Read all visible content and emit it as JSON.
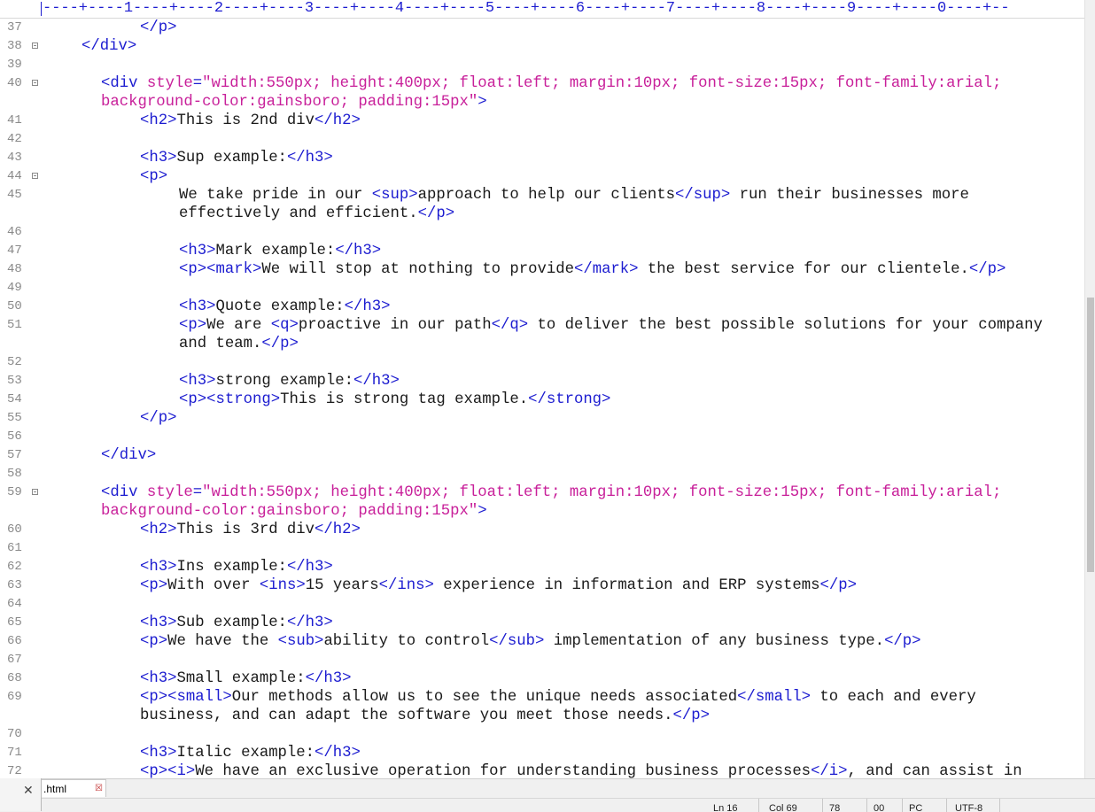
{
  "ruler": {
    "text": "----+----1----+----2----+----3----+----4----+----5----+----6----+----7----+----8----+----9----+----0----+--"
  },
  "lines": [
    {
      "n": "37",
      "fold": false,
      "indent": 8,
      "segs": [
        [
          "t",
          "</p>"
        ]
      ]
    },
    {
      "n": "38",
      "fold": true,
      "indent": 2,
      "segs": [
        [
          "t",
          "</div>"
        ]
      ]
    },
    {
      "n": "39",
      "fold": false,
      "indent": 0,
      "segs": []
    },
    {
      "n": "40",
      "fold": true,
      "indent": 4,
      "segs": [
        [
          "t",
          "<div "
        ],
        [
          "a",
          "style"
        ],
        [
          "t",
          "="
        ],
        [
          "s",
          "\"width:550px; height:400px; float:left; margin:10px; font-size:15px; font-family:arial;"
        ]
      ]
    },
    {
      "n": "",
      "fold": false,
      "indent": 4,
      "segs": [
        [
          "s",
          "background-color:gainsboro; padding:15px\""
        ],
        [
          "t",
          ">"
        ]
      ]
    },
    {
      "n": "41",
      "fold": false,
      "indent": 8,
      "segs": [
        [
          "t",
          "<h2>"
        ],
        [
          "x",
          "This is 2nd div"
        ],
        [
          "t",
          "</h2>"
        ]
      ]
    },
    {
      "n": "42",
      "fold": false,
      "indent": 0,
      "segs": []
    },
    {
      "n": "43",
      "fold": false,
      "indent": 8,
      "segs": [
        [
          "t",
          "<h3>"
        ],
        [
          "x",
          "Sup example:"
        ],
        [
          "t",
          "</h3>"
        ]
      ]
    },
    {
      "n": "44",
      "fold": true,
      "indent": 8,
      "segs": [
        [
          "t",
          "<p>"
        ]
      ]
    },
    {
      "n": "45",
      "fold": false,
      "indent": 12,
      "segs": [
        [
          "x",
          "We take pride in our "
        ],
        [
          "t",
          "<sup>"
        ],
        [
          "x",
          "approach to help our clients"
        ],
        [
          "t",
          "</sup>"
        ],
        [
          "x",
          " run their businesses more"
        ]
      ]
    },
    {
      "n": "",
      "fold": false,
      "indent": 12,
      "segs": [
        [
          "x",
          "effectively and efficient."
        ],
        [
          "t",
          "</p>"
        ]
      ]
    },
    {
      "n": "46",
      "fold": false,
      "indent": 0,
      "segs": []
    },
    {
      "n": "47",
      "fold": false,
      "indent": 12,
      "segs": [
        [
          "t",
          "<h3>"
        ],
        [
          "x",
          "Mark example:"
        ],
        [
          "t",
          "</h3>"
        ]
      ]
    },
    {
      "n": "48",
      "fold": false,
      "indent": 12,
      "segs": [
        [
          "t",
          "<p><mark>"
        ],
        [
          "x",
          "We will stop at nothing to provide"
        ],
        [
          "t",
          "</mark>"
        ],
        [
          "x",
          " the best service for our clientele."
        ],
        [
          "t",
          "</p>"
        ]
      ]
    },
    {
      "n": "49",
      "fold": false,
      "indent": 0,
      "segs": []
    },
    {
      "n": "50",
      "fold": false,
      "indent": 12,
      "segs": [
        [
          "t",
          "<h3>"
        ],
        [
          "x",
          "Quote example:"
        ],
        [
          "t",
          "</h3>"
        ]
      ]
    },
    {
      "n": "51",
      "fold": false,
      "indent": 12,
      "segs": [
        [
          "t",
          "<p>"
        ],
        [
          "x",
          "We are "
        ],
        [
          "t",
          "<q>"
        ],
        [
          "x",
          "proactive in our path"
        ],
        [
          "t",
          "</q>"
        ],
        [
          "x",
          " to deliver the best possible solutions for your company"
        ]
      ]
    },
    {
      "n": "",
      "fold": false,
      "indent": 12,
      "segs": [
        [
          "x",
          "and team."
        ],
        [
          "t",
          "</p>"
        ]
      ]
    },
    {
      "n": "52",
      "fold": false,
      "indent": 0,
      "segs": []
    },
    {
      "n": "53",
      "fold": false,
      "indent": 12,
      "segs": [
        [
          "t",
          "<h3>"
        ],
        [
          "x",
          "strong example:"
        ],
        [
          "t",
          "</h3>"
        ]
      ]
    },
    {
      "n": "54",
      "fold": false,
      "indent": 12,
      "segs": [
        [
          "t",
          "<p><strong>"
        ],
        [
          "x",
          "This is strong tag example."
        ],
        [
          "t",
          "</strong>"
        ]
      ]
    },
    {
      "n": "55",
      "fold": false,
      "indent": 8,
      "segs": [
        [
          "t",
          "</p>"
        ]
      ]
    },
    {
      "n": "56",
      "fold": false,
      "indent": 0,
      "segs": []
    },
    {
      "n": "57",
      "fold": false,
      "indent": 4,
      "segs": [
        [
          "t",
          "</div>"
        ]
      ]
    },
    {
      "n": "58",
      "fold": false,
      "indent": 0,
      "segs": []
    },
    {
      "n": "59",
      "fold": true,
      "indent": 4,
      "segs": [
        [
          "t",
          "<div "
        ],
        [
          "a",
          "style"
        ],
        [
          "t",
          "="
        ],
        [
          "s",
          "\"width:550px; height:400px; float:left; margin:10px; font-size:15px; font-family:arial;"
        ]
      ]
    },
    {
      "n": "",
      "fold": false,
      "indent": 4,
      "segs": [
        [
          "s",
          "background-color:gainsboro; padding:15px\""
        ],
        [
          "t",
          ">"
        ]
      ]
    },
    {
      "n": "60",
      "fold": false,
      "indent": 8,
      "segs": [
        [
          "t",
          "<h2>"
        ],
        [
          "x",
          "This is 3rd div"
        ],
        [
          "t",
          "</h2>"
        ]
      ]
    },
    {
      "n": "61",
      "fold": false,
      "indent": 0,
      "segs": []
    },
    {
      "n": "62",
      "fold": false,
      "indent": 8,
      "segs": [
        [
          "t",
          "<h3>"
        ],
        [
          "x",
          "Ins example:"
        ],
        [
          "t",
          "</h3>"
        ]
      ]
    },
    {
      "n": "63",
      "fold": false,
      "indent": 8,
      "segs": [
        [
          "t",
          "<p>"
        ],
        [
          "x",
          "With over "
        ],
        [
          "t",
          "<ins>"
        ],
        [
          "x",
          "15 years"
        ],
        [
          "t",
          "</ins>"
        ],
        [
          "x",
          " experience in information and ERP systems"
        ],
        [
          "t",
          "</p>"
        ]
      ]
    },
    {
      "n": "64",
      "fold": false,
      "indent": 0,
      "segs": []
    },
    {
      "n": "65",
      "fold": false,
      "indent": 8,
      "segs": [
        [
          "t",
          "<h3>"
        ],
        [
          "x",
          "Sub example:"
        ],
        [
          "t",
          "</h3>"
        ]
      ]
    },
    {
      "n": "66",
      "fold": false,
      "indent": 8,
      "segs": [
        [
          "t",
          "<p>"
        ],
        [
          "x",
          "We have the "
        ],
        [
          "t",
          "<sub>"
        ],
        [
          "x",
          "ability to control"
        ],
        [
          "t",
          "</sub>"
        ],
        [
          "x",
          " implementation of any business type."
        ],
        [
          "t",
          "</p>"
        ]
      ]
    },
    {
      "n": "67",
      "fold": false,
      "indent": 0,
      "segs": []
    },
    {
      "n": "68",
      "fold": false,
      "indent": 8,
      "segs": [
        [
          "t",
          "<h3>"
        ],
        [
          "x",
          "Small example:"
        ],
        [
          "t",
          "</h3>"
        ]
      ]
    },
    {
      "n": "69",
      "fold": false,
      "indent": 8,
      "segs": [
        [
          "t",
          "<p><small>"
        ],
        [
          "x",
          "Our methods allow us to see the unique needs associated"
        ],
        [
          "t",
          "</small>"
        ],
        [
          "x",
          " to each and every"
        ]
      ]
    },
    {
      "n": "",
      "fold": false,
      "indent": 8,
      "segs": [
        [
          "x",
          "business, and can adapt the software you meet those needs."
        ],
        [
          "t",
          "</p>"
        ]
      ]
    },
    {
      "n": "70",
      "fold": false,
      "indent": 0,
      "segs": []
    },
    {
      "n": "71",
      "fold": false,
      "indent": 8,
      "segs": [
        [
          "t",
          "<h3>"
        ],
        [
          "x",
          "Italic example:"
        ],
        [
          "t",
          "</h3>"
        ]
      ]
    },
    {
      "n": "72",
      "fold": false,
      "indent": 8,
      "segs": [
        [
          "t",
          "<p><i>"
        ],
        [
          "x",
          "We have an exclusive operation for understanding business processes"
        ],
        [
          "t",
          "</i>"
        ],
        [
          "x",
          ", and can assist in"
        ]
      ]
    }
  ],
  "tab": {
    "label": ".html",
    "close_glyph": "☒"
  },
  "close_panel": {
    "glyph": "✕"
  },
  "status": {
    "ln": "Ln 16",
    "col": "Col 69",
    "sel": "78",
    "ovr": "00",
    "eol": "PC",
    "encoding": "UTF-8"
  }
}
